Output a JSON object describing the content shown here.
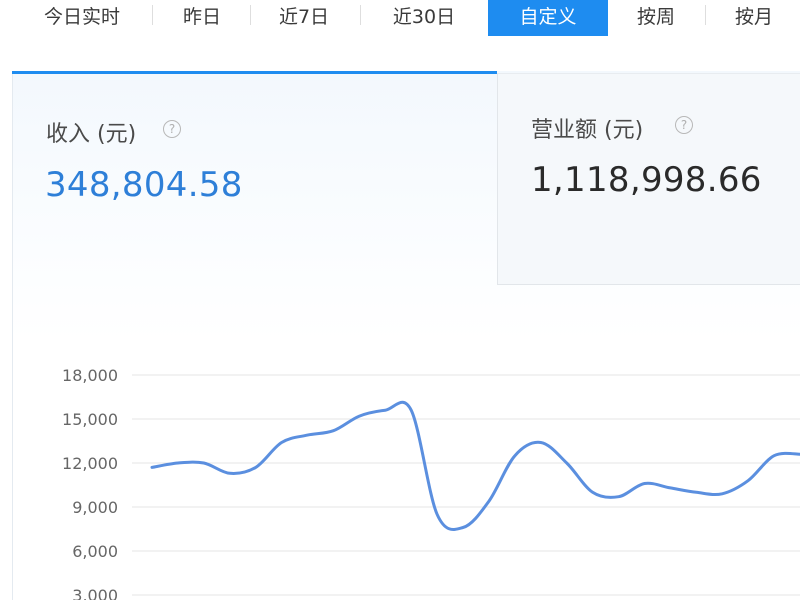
{
  "tabs": {
    "items": [
      {
        "label": "今日实时",
        "active": false
      },
      {
        "label": "昨日",
        "active": false
      },
      {
        "label": "近7日",
        "active": false
      },
      {
        "label": "近30日",
        "active": false
      },
      {
        "label": "自定义",
        "active": true
      },
      {
        "label": "按周",
        "active": false
      },
      {
        "label": "按月",
        "active": false
      }
    ]
  },
  "metrics": {
    "income": {
      "label": "收入 (元)",
      "value": "348,804.58",
      "help_icon": "question-circle-icon"
    },
    "revenue": {
      "label": "营业额 (元)",
      "value": "1,118,998.66",
      "help_icon": "question-circle-icon"
    }
  },
  "colors": {
    "accent": "#1e8cf0",
    "income_value": "#2e7fd8",
    "line": "#5b8fdf",
    "grid": "#e6e6e6"
  },
  "chart_data": {
    "type": "line",
    "y_ticks": [
      "18,000",
      "15,000",
      "12,000",
      "9,000",
      "6,000",
      "3,000"
    ],
    "ylim": [
      3000,
      18000
    ],
    "grid": true,
    "series": [
      {
        "values": [
          11700,
          12000,
          12000,
          11300,
          11700,
          13400,
          13900,
          14200,
          15200,
          15600,
          15600,
          8500,
          7600,
          9400,
          12500,
          13400,
          12000,
          10000,
          9700,
          10600,
          10300,
          10000,
          9900,
          10800,
          12500,
          12600
        ]
      }
    ]
  }
}
